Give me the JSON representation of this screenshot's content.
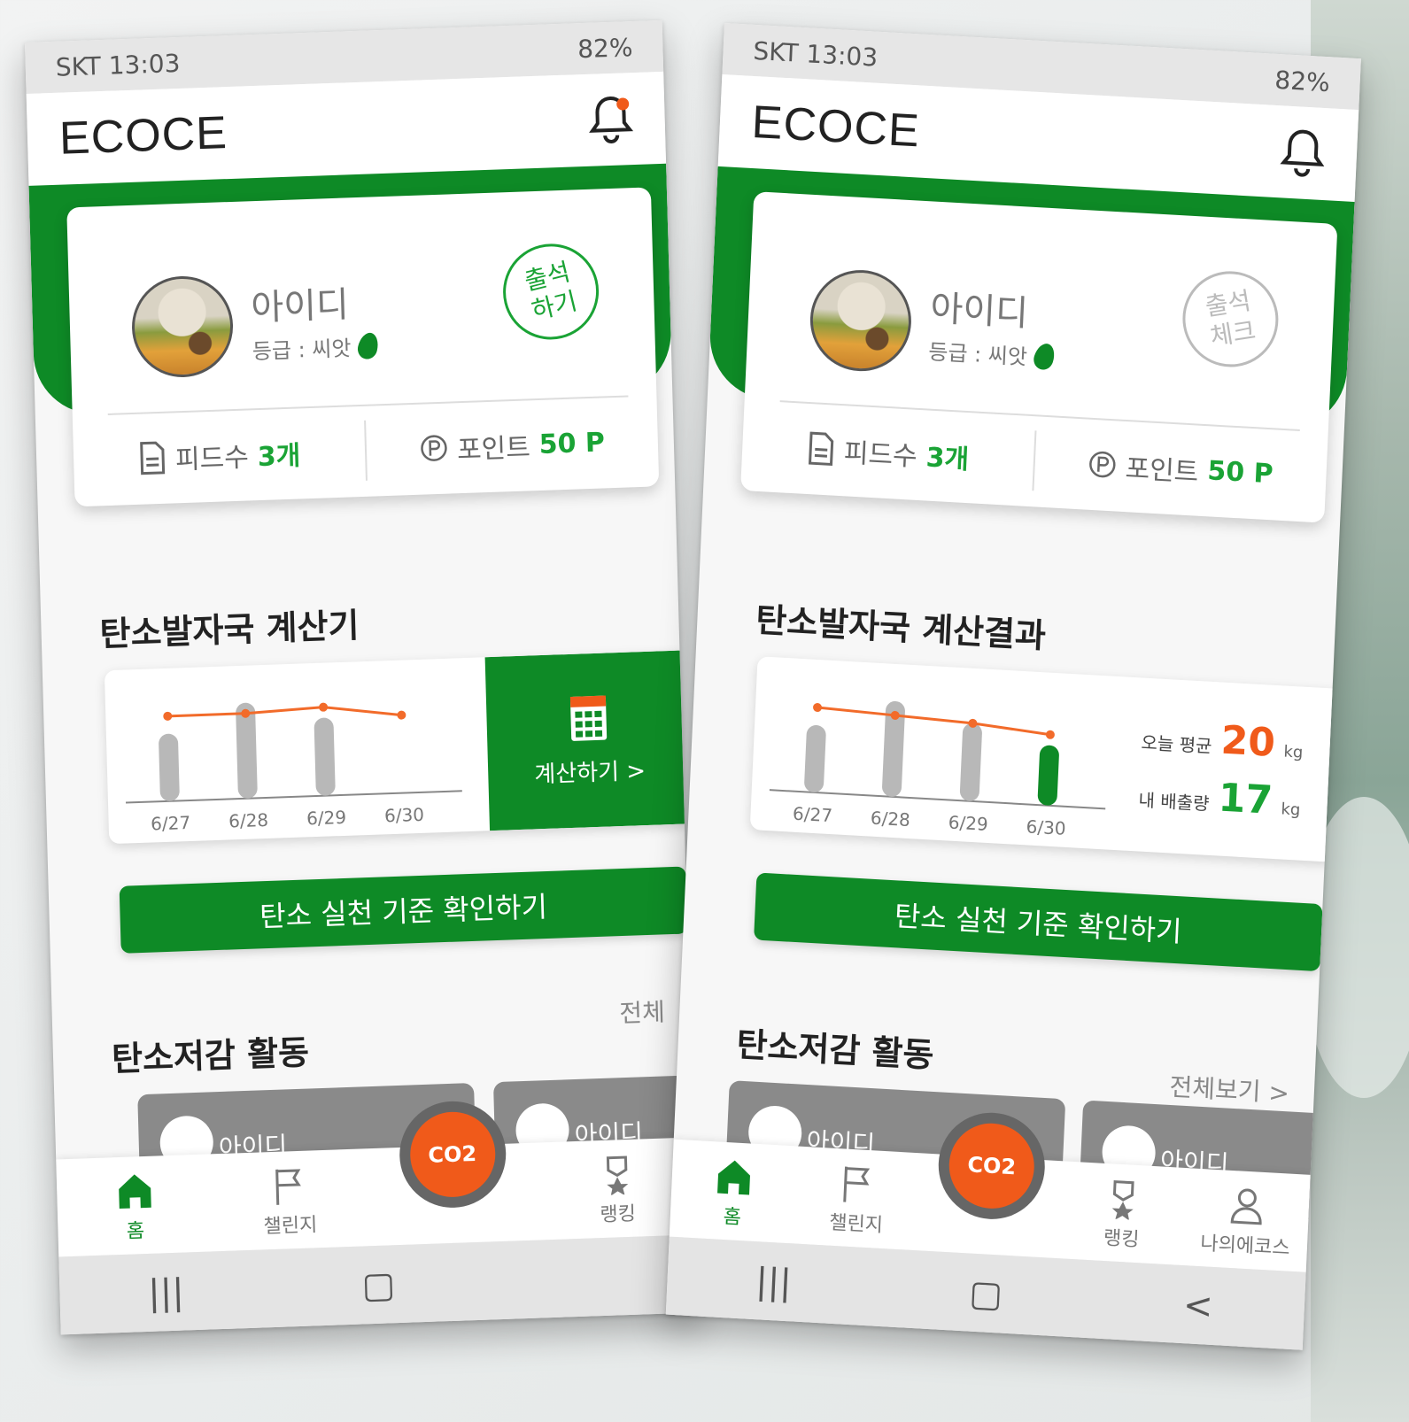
{
  "screens": [
    {
      "status": {
        "carrier_time": "SKT 13:03",
        "battery": "82%"
      },
      "app_title": "ECOCE",
      "profile": {
        "user_id": "아이디",
        "grade": "등급 : 씨앗",
        "attendance_label": "출석\n하기"
      },
      "stats": {
        "feeds_label": "피드수",
        "feeds_value": "3개",
        "points_label": "포인트",
        "points_value": "50 P"
      },
      "calc_section_title": "탄소발자국 계산기",
      "chart_data": {
        "type": "bar",
        "categories": [
          "6/27",
          "6/28",
          "6/29",
          "6/30"
        ],
        "series": [
          {
            "values": [
              19,
              27,
              22,
              0
            ]
          },
          {
            "values": [
              24,
              24,
              25,
              22
            ]
          }
        ],
        "colors": [
          "#b8b8b8",
          "#f26b2a"
        ]
      },
      "calc_button": "계산하기 >",
      "standards_button": "탄소 실천 기준 확인하기",
      "activity_title": "탄소저감 활동",
      "activity_viewall": "전체",
      "activity_cards": [
        {
          "name": "아이디"
        },
        {
          "name": "아이디"
        }
      ],
      "tabs": [
        {
          "label": "홈",
          "icon": "home-icon",
          "active": true
        },
        {
          "label": "챌린지",
          "icon": "flag-icon",
          "active": false
        },
        {
          "label": "CO2",
          "icon": "co2-cloud-icon",
          "active": false
        },
        {
          "label": "랭킹",
          "icon": "medal-icon",
          "active": false
        }
      ],
      "nav": [
        "|||",
        "▢"
      ]
    },
    {
      "status": {
        "carrier_time": "SKT 13:03",
        "battery": "82%"
      },
      "app_title": "ECOCE",
      "profile": {
        "user_id": "아이디",
        "grade": "등급 : 씨앗",
        "attendance_label": "출석\n체크"
      },
      "stats": {
        "feeds_label": "피드수",
        "feeds_value": "3개",
        "points_label": "포인트",
        "points_value": "50 P"
      },
      "calc_section_title": "탄소발자국 계산결과",
      "chart_data": {
        "type": "bar",
        "categories": [
          "6/27",
          "6/28",
          "6/29",
          "6/30"
        ],
        "series": [
          {
            "values": [
              19,
              27,
              22,
              17
            ]
          },
          {
            "values": [
              24,
              23,
              22,
              20
            ]
          }
        ],
        "colors": [
          "#b8b8b8",
          "#f26b2a"
        ]
      },
      "summary": {
        "avg_label": "오늘 평균",
        "avg_value": "20",
        "avg_unit": "kg",
        "mine_label": "내 배출량",
        "mine_value": "17",
        "mine_unit": "kg"
      },
      "standards_button": "탄소 실천 기준 확인하기",
      "activity_title": "탄소저감 활동",
      "activity_viewall": "전체보기 >",
      "activity_cards": [
        {
          "name": "아이디"
        },
        {
          "name": "아이디"
        }
      ],
      "tabs": [
        {
          "label": "홈",
          "icon": "home-icon",
          "active": true
        },
        {
          "label": "챌린지",
          "icon": "flag-icon",
          "active": false
        },
        {
          "label": "CO2",
          "icon": "co2-cloud-icon",
          "active": false
        },
        {
          "label": "랭킹",
          "icon": "medal-icon",
          "active": false
        },
        {
          "label": "나의에코스",
          "icon": "person-icon",
          "active": false
        }
      ],
      "nav": [
        "|||",
        "▢",
        "<"
      ]
    }
  ],
  "colors": {
    "brand_green": "#0e8a26",
    "accent_orange": "#f05a1a"
  }
}
